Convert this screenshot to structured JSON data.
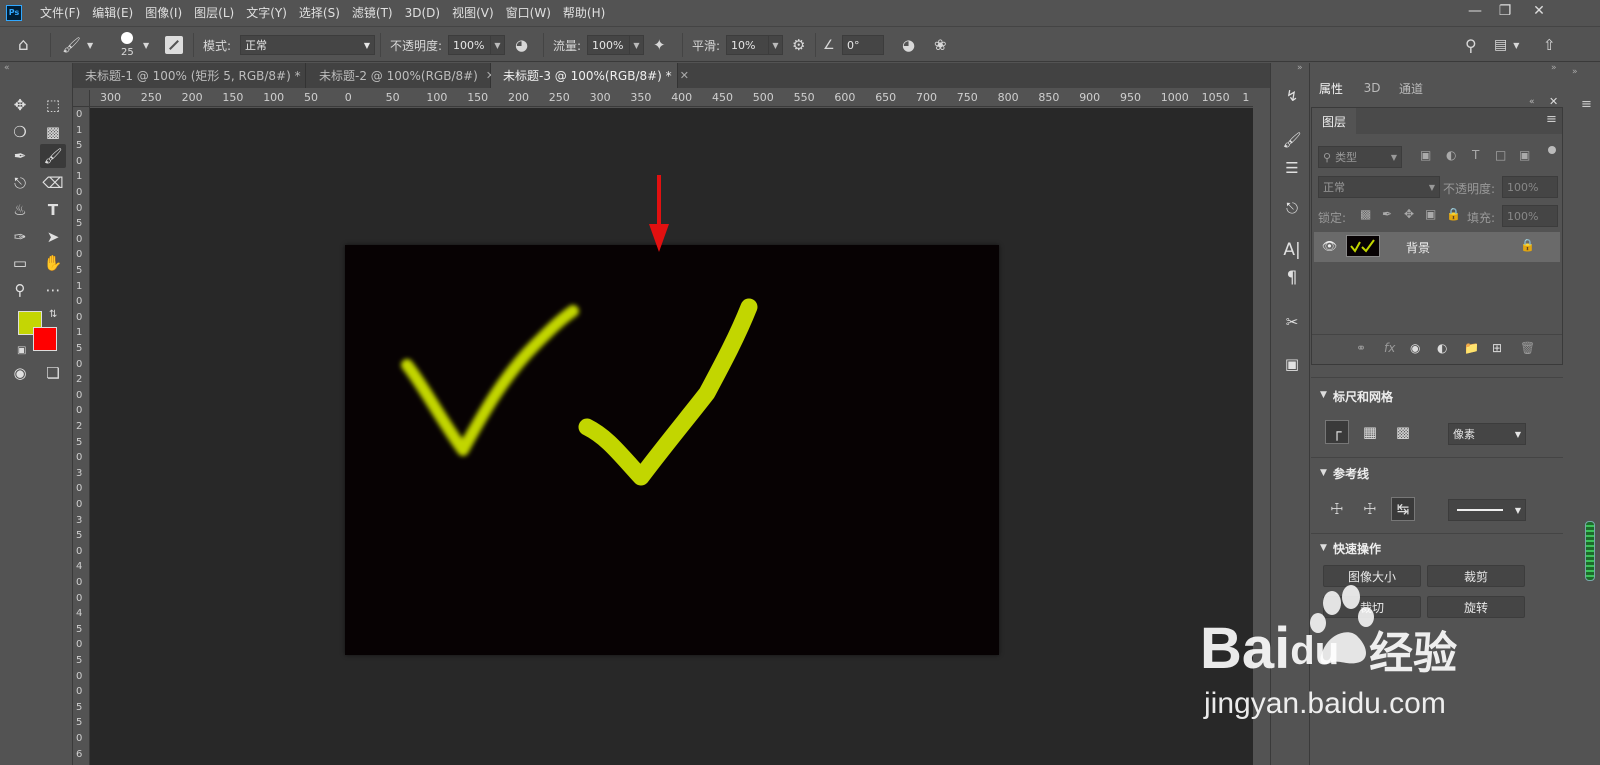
{
  "app": {
    "logo_text": "Ps"
  },
  "menu": [
    "文件(F)",
    "编辑(E)",
    "图像(I)",
    "图层(L)",
    "文字(Y)",
    "选择(S)",
    "滤镜(T)",
    "3D(D)",
    "视图(V)",
    "窗口(W)",
    "帮助(H)"
  ],
  "options": {
    "brush_size": "25",
    "mode_label": "模式:",
    "mode_value": "正常",
    "opacity_label": "不透明度:",
    "opacity_value": "100%",
    "flow_label": "流量:",
    "flow_value": "100%",
    "smooth_label": "平滑:",
    "smooth_value": "10%",
    "angle_value": "0°"
  },
  "tabs": [
    {
      "label": "未标题-1 @ 100% (矩形 5, RGB/8#) *"
    },
    {
      "label": "未标题-2 @ 100%(RGB/8#)"
    },
    {
      "label": "未标题-3 @ 100%(RGB/8#) *"
    }
  ],
  "ruler": {
    "h_labels": [
      "300",
      "250",
      "200",
      "150",
      "100",
      "50",
      "0",
      "50",
      "100",
      "150",
      "200",
      "250",
      "300",
      "350",
      "400",
      "450",
      "500",
      "550",
      "600",
      "650",
      "700",
      "750",
      "800",
      "850",
      "900",
      "950",
      "1000",
      "1050",
      "1"
    ],
    "v_labels": [
      "0",
      "1",
      "5",
      "0",
      "1",
      "0",
      "0",
      "5",
      "0",
      "0",
      "5",
      "1",
      "0",
      "0",
      "1",
      "5",
      "0",
      "2",
      "0",
      "0",
      "2",
      "5",
      "0",
      "3",
      "0",
      "0",
      "3",
      "5",
      "0",
      "4",
      "0",
      "0",
      "4",
      "5",
      "0",
      "5",
      "0",
      "0",
      "5",
      "5",
      "0",
      "6"
    ]
  },
  "colors": {
    "foreground": "#c4d604",
    "background": "#ff0000",
    "stroke": "#c2d600",
    "arrow": "#e21010"
  },
  "panels": {
    "tab_properties": "属性",
    "tab_3d": "3D",
    "tab_channels": "通道",
    "layers_title": "图层",
    "filter_kind": "类型",
    "blend_mode": "正常",
    "opacity_label": "不透明度:",
    "opacity_value": "100%",
    "lock_label": "锁定:",
    "fill_label": "填充:",
    "fill_value": "100%",
    "layer_name": "背景",
    "section_rulers": "标尺和网格",
    "units_value": "像素",
    "section_guides": "参考线",
    "section_quick": "快速操作",
    "btn_image_size": "图像大小",
    "btn_crop": "裁剪",
    "btn_trim": "裁切",
    "btn_rotate": "旋转"
  },
  "watermark": {
    "brand": "Bai",
    "brand2": "du",
    "cn": "经验",
    "url": "jingyan.baidu.com"
  }
}
